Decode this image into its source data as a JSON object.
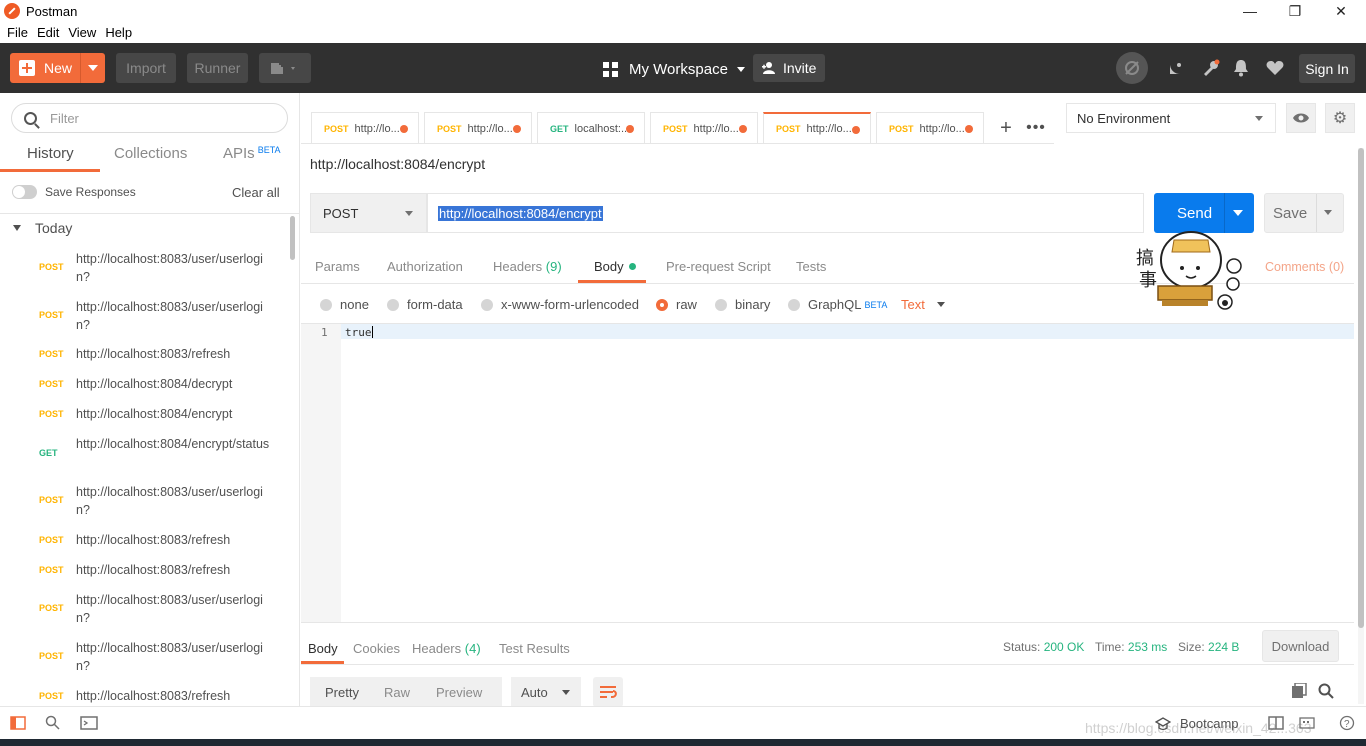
{
  "window": {
    "title": "Postman",
    "controls": [
      "minimize",
      "maximize",
      "close"
    ]
  },
  "menu": [
    "File",
    "Edit",
    "View",
    "Help"
  ],
  "header": {
    "new_label": "New",
    "import_label": "Import",
    "runner_label": "Runner",
    "workspace_label": "My Workspace",
    "invite_label": "Invite",
    "signin_label": "Sign In"
  },
  "sidebar": {
    "filter_placeholder": "Filter",
    "tabs": {
      "history": "History",
      "collections": "Collections",
      "apis": "APIs",
      "apis_badge": "BETA"
    },
    "save_responses": "Save Responses",
    "clear_all": "Clear all",
    "group": "Today",
    "history": [
      {
        "method": "POST",
        "url": "http://localhost:8083/user/userlogin?"
      },
      {
        "method": "POST",
        "url": "http://localhost:8083/user/userlogin?"
      },
      {
        "method": "POST",
        "url": "http://localhost:8083/refresh"
      },
      {
        "method": "POST",
        "url": "http://localhost:8084/decrypt"
      },
      {
        "method": "POST",
        "url": "http://localhost:8084/encrypt"
      },
      {
        "method": "GET",
        "url": "http://localhost:8084/encrypt/status"
      },
      {
        "method": "POST",
        "url": "http://localhost:8083/user/userlogin?"
      },
      {
        "method": "POST",
        "url": "http://localhost:8083/refresh"
      },
      {
        "method": "POST",
        "url": "http://localhost:8083/refresh"
      },
      {
        "method": "POST",
        "url": "http://localhost:8083/user/userlogin?"
      },
      {
        "method": "POST",
        "url": "http://localhost:8083/user/userlogin?"
      },
      {
        "method": "POST",
        "url": "http://localhost:8083/refresh"
      }
    ]
  },
  "tabs": [
    {
      "method": "POST",
      "label": "http://lo..."
    },
    {
      "method": "POST",
      "label": "http://lo..."
    },
    {
      "method": "GET",
      "label": "localhost:..."
    },
    {
      "method": "POST",
      "label": "http://lo..."
    },
    {
      "method": "POST",
      "label": "http://lo..."
    },
    {
      "method": "POST",
      "label": "http://lo..."
    }
  ],
  "environment": {
    "selected": "No Environment"
  },
  "request": {
    "title": "http://localhost:8084/encrypt",
    "method": "POST",
    "url": "http://localhost:8084/encrypt",
    "send_label": "Send",
    "save_label": "Save",
    "tabs": {
      "params": "Params",
      "authorization": "Authorization",
      "headers": "Headers",
      "headers_count": "(9)",
      "body": "Body",
      "prerequest": "Pre-request Script",
      "tests": "Tests"
    },
    "comments": "Comments (0)",
    "body_types": {
      "none": "none",
      "form_data": "form-data",
      "urlencoded": "x-www-form-urlencoded",
      "raw": "raw",
      "binary": "binary",
      "graphql": "GraphQL",
      "graphql_badge": "BETA"
    },
    "raw_format": "Text",
    "body_line_number": "1",
    "body_text": "true"
  },
  "response": {
    "tabs": {
      "body": "Body",
      "cookies": "Cookies",
      "headers": "Headers",
      "headers_count": "(4)",
      "test_results": "Test Results"
    },
    "status_label": "Status:",
    "status_value": "200 OK",
    "time_label": "Time:",
    "time_value": "253 ms",
    "size_label": "Size:",
    "size_value": "224 B",
    "download_label": "Download",
    "format_tabs": {
      "pretty": "Pretty",
      "raw": "Raw",
      "preview": "Preview"
    },
    "format_select": "Auto"
  },
  "sticker_text": [
    "搞",
    "事"
  ],
  "statusbar": {
    "bootcamp": "Bootcamp",
    "watermark": "https://blog.csdn.net/weixin_42...363"
  },
  "colors": {
    "accent": "#f26b3a",
    "send_blue": "#097bed",
    "get_green": "#26b47f",
    "post_orange": "#ffb400",
    "header_bg": "#303030"
  }
}
